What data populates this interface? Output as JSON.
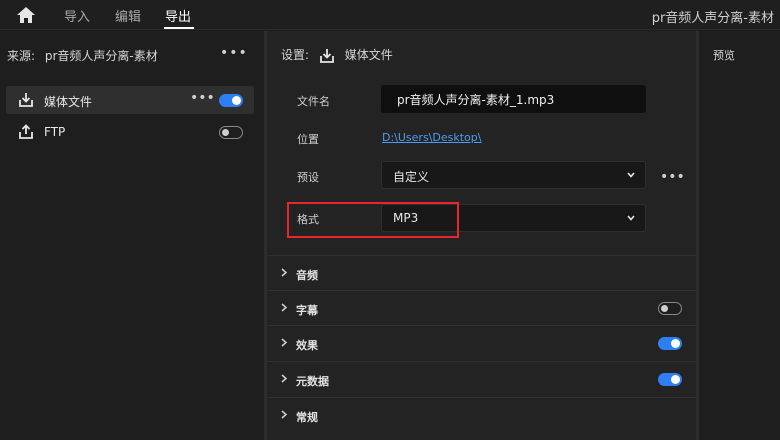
{
  "topbar": {
    "tabs": [
      {
        "label": "导入"
      },
      {
        "label": "编辑"
      },
      {
        "label": "导出"
      }
    ],
    "app_title": "pr音频人声分离-素材"
  },
  "source_panel": {
    "label": "来源:",
    "name": "pr音频人声分离-素材",
    "items": [
      {
        "label": "媒体文件",
        "enabled": true
      },
      {
        "label": "FTP",
        "enabled": false
      }
    ]
  },
  "settings": {
    "label": "设置:",
    "destination": "媒体文件",
    "file_name": {
      "label": "文件名",
      "value": "pr音频人声分离-素材_1.mp3"
    },
    "location": {
      "label": "位置",
      "value": "D:\\Users\\Desktop\\"
    },
    "preset": {
      "label": "预设",
      "value": "自定义"
    },
    "format": {
      "label": "格式",
      "value": "MP3"
    },
    "sections": [
      {
        "label": "音频"
      },
      {
        "label": "字幕",
        "enabled": false
      },
      {
        "label": "效果",
        "enabled": true
      },
      {
        "label": "元数据",
        "enabled": true
      },
      {
        "label": "常规"
      }
    ]
  },
  "preview": {
    "label": "预览"
  },
  "colors": {
    "accent": "#2d7ff3",
    "highlight": "#e8262f",
    "link": "#4d9bf5"
  },
  "icons": [
    "home-icon",
    "export-icon",
    "upload-icon",
    "more-icon",
    "chevron-down-icon",
    "chevron-right-icon"
  ]
}
